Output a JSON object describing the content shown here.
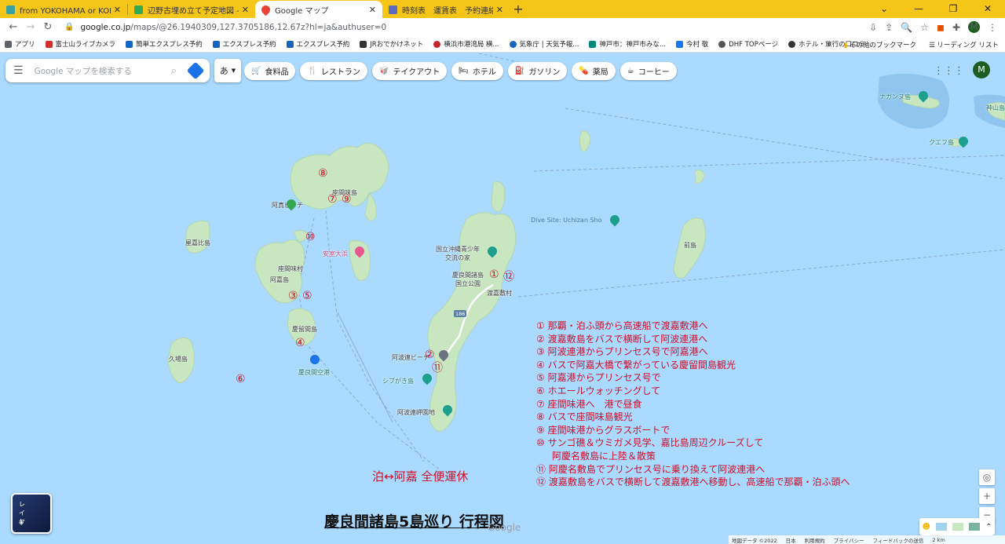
{
  "browser": {
    "tabs": [
      {
        "title": "from YOKOHAMA or KOBE？ | Th",
        "color": "#3aa0a0",
        "active": false
      },
      {
        "title": "辺野古埋め立て予定地図 - Google",
        "color": "#34a853",
        "active": false
      },
      {
        "title": "Google マップ",
        "color": "#ea4335",
        "active": true
      },
      {
        "title": "時刻表　運賃表　予約連絡先 - 渡",
        "color": "#5c6bc0",
        "active": false
      }
    ],
    "new_tab": "+",
    "window_controls": [
      "⌄",
      "—",
      "❐",
      "✕"
    ],
    "url_host": "google.co.jp",
    "url_path": "/maps/@26.1940309,127.3705186,12.67z?hl=ja&authuser=0",
    "profile_letter": "M",
    "bookmarks": [
      {
        "label": "アプリ",
        "color": "#5f6368"
      },
      {
        "label": "富士山ライブカメラ",
        "color": "#d32f2f"
      },
      {
        "label": "簡単エクスプレス予約",
        "color": "#1565c0"
      },
      {
        "label": "エクスプレス予約",
        "color": "#1565c0"
      },
      {
        "label": "エクスプレス予約",
        "color": "#1565c0"
      },
      {
        "label": "JRおでかけネット",
        "color": "#333"
      },
      {
        "label": "横浜市港湾局 横...",
        "color": "#c62828"
      },
      {
        "label": "気象庁 | 天気予報...",
        "color": "#1565c0"
      },
      {
        "label": "神戸市：神戸市みな...",
        "color": "#00897b"
      },
      {
        "label": "今村 敬",
        "color": "#1877f2"
      },
      {
        "label": "DHF TOPページ",
        "color": "#555"
      },
      {
        "label": "ホテル・旅行の口コミ...",
        "color": "#333"
      }
    ],
    "bookmarks_more": "»",
    "other_bookmarks": "その他のブックマーク",
    "reading_list": "リーディング リスト"
  },
  "maps": {
    "search_placeholder": "Google マップを検索する",
    "ime": "あ",
    "chips": [
      {
        "icon": "🛒",
        "label": "食料品"
      },
      {
        "icon": "🍴",
        "label": "レストラン"
      },
      {
        "icon": "🥡",
        "label": "テイクアウト"
      },
      {
        "icon": "🛏",
        "label": "ホテル"
      },
      {
        "icon": "⛽",
        "label": "ガソリン"
      },
      {
        "icon": "💊",
        "label": "薬局"
      },
      {
        "icon": "☕",
        "label": "コーヒー"
      }
    ],
    "avatar_letter": "M",
    "place_labels": {
      "nagannu": "ナガンヌ島",
      "kamiyama": "神山島",
      "kuefu": "クエフ島",
      "dive_site": "Dive Site: Uchizan Sho",
      "maejima": "前島",
      "zamami": "座間味島",
      "ama_beach": "阿真ビーチ",
      "yakabi": "屋嘉比島",
      "ankeno": "安室大浜",
      "zamami_mura": "座間味村",
      "aka": "阿嘉島",
      "geruma": "慶留間島",
      "kuba": "久場島",
      "kerama_airport": "慶良間空港",
      "seishonen": "国立沖縄青少年\n交流の家",
      "kerama_park": "慶良間諸島\n国立公園",
      "tokashiki_village": "渡嘉敷村",
      "route": "186",
      "aharen_port": "阿波連ビーチ",
      "shibugaki": "シブがき島",
      "aharen_cape": "阿波連岬園地"
    },
    "markers": [
      "⑧",
      "⑦",
      "⑨",
      "⑩",
      "③",
      "⑤",
      "④",
      "⑥",
      "①",
      "⑫",
      "②",
      "⑪"
    ],
    "itinerary": [
      "①  那覇・泊ふ頭から高速船で渡嘉敷港へ",
      "②  渡嘉敷島をバスで横断して阿波連港へ",
      "③  阿波連港からプリンセス号で阿嘉港へ",
      "④  バスで阿嘉大橋で繋がっている慶留間島観光",
      "⑤  阿嘉港からプリンセス号で",
      "⑥  ホエールウォッチングして",
      "⑦  座間味港へ　港で昼食",
      "⑧  バスで座間味島観光",
      "⑨  座間味港からグラスボートで",
      "⑩  サンゴ礁＆ウミガメ見学、嘉比島周辺クルーズして"
    ],
    "itinerary_indent": "阿慶名敷島に上陸＆散策",
    "itinerary_after": [
      "⑪  阿慶名敷島でプリンセス号に乗り換えて阿波連港へ",
      "⑫  渡嘉敷島をバスで横断して渡嘉敷港へ移動し、高速船で那覇・泊ふ頭へ"
    ],
    "notice": "泊↔阿嘉 全便運休",
    "title": "慶良間諸島5島巡り 行程図",
    "google_logo": "Google",
    "layers_label": "レイヤ",
    "zoom_in": "+",
    "zoom_out": "−",
    "footer": [
      "地図データ ©2022",
      "日本",
      "利用規約",
      "プライバシー",
      "フィードバックの送信",
      "2 km"
    ],
    "colors": {
      "water": "#aadaff",
      "land": "#c8e6c0",
      "marker_red": "#c0182c"
    }
  }
}
